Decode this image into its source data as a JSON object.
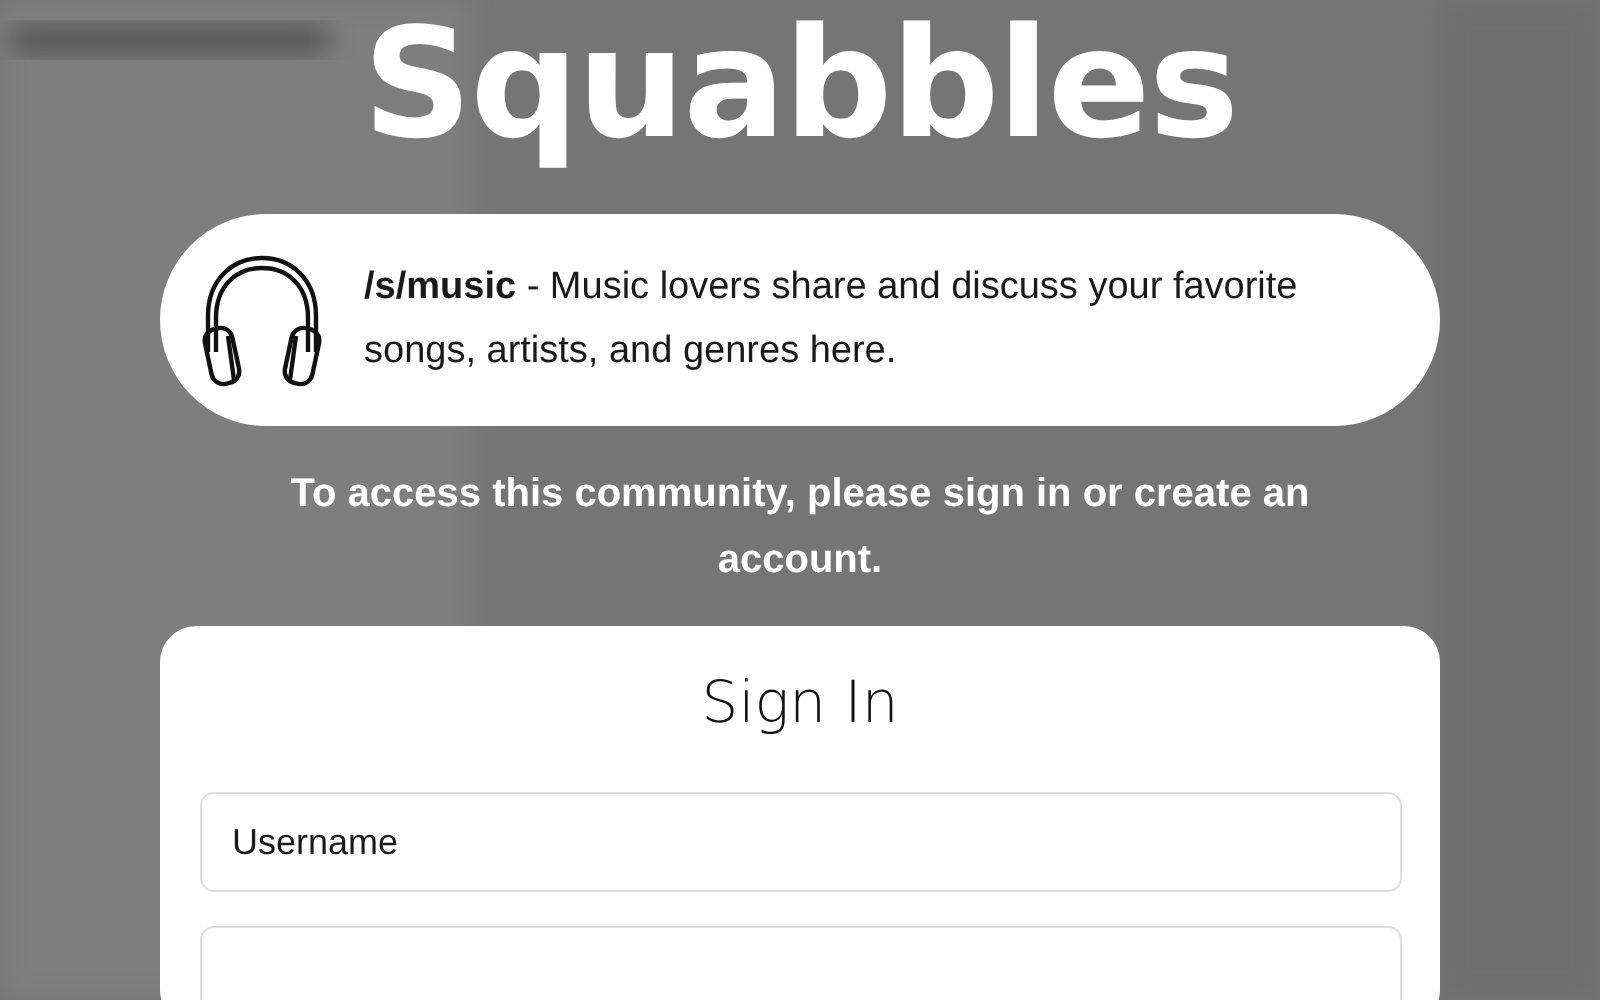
{
  "logo": {
    "title": "Squabbles"
  },
  "community": {
    "name": "/s/music",
    "description": " - Music lovers share and discuss your favorite songs, artists, and genres here."
  },
  "notice": "To access this community, please sign in or create an account.",
  "sign_in": {
    "heading": "Sign In",
    "fields": [
      {
        "placeholder": "Username"
      }
    ]
  }
}
